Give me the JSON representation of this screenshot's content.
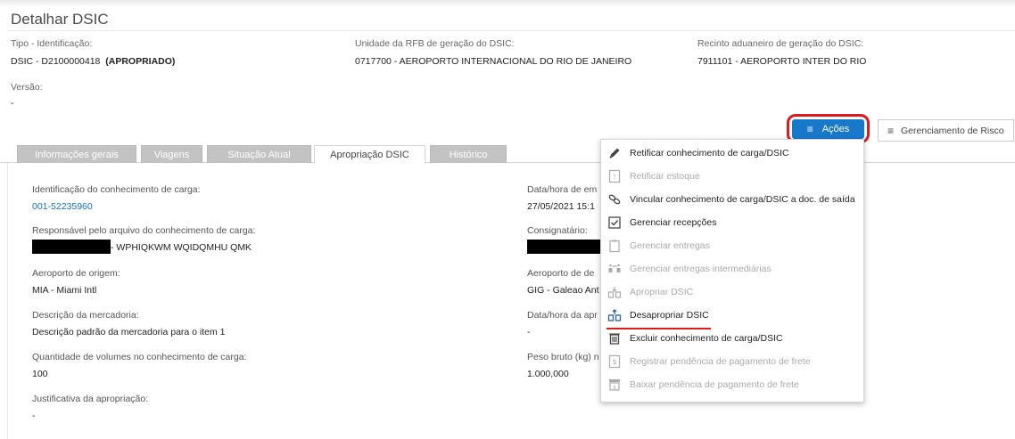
{
  "title": "Detalhar DSIC",
  "header": {
    "tipo_label": "Tipo - Identificação:",
    "tipo_value": "DSIC - D2100000418",
    "tipo_status": "(APROPRIADO)",
    "unidade_label": "Unidade da RFB de geração do DSIC:",
    "unidade_value": "0717700 - AEROPORTO INTERNACIONAL DO RIO DE JANEIRO",
    "recinto_label": "Recinto aduaneiro de geração do DSIC:",
    "recinto_value": "7911101 - AEROPORTO INTER DO RIO",
    "versao_label": "Versão:",
    "versao_value": "-"
  },
  "buttons": {
    "acoes": "Ações",
    "risco": "Gerenciamento de Risco"
  },
  "tabs": [
    {
      "label": "Informações gerais"
    },
    {
      "label": "Viagens"
    },
    {
      "label": "Situação Atual"
    },
    {
      "label": "Apropriação DSIC"
    },
    {
      "label": "Histórico"
    }
  ],
  "fields": {
    "ident_label": "Identificação do conhecimento de carga:",
    "ident_value": "001-52235960",
    "data_label": "Data/hora de em",
    "data_value": "27/05/2021 15:1",
    "resp_label": "Responsável pelo arquivo do conhecimento de carga:",
    "resp_value": "- WPHIQKWM WQIDQMHU QMK",
    "consig_label": "Consignatário:",
    "origem_label": "Aeroporto de origem:",
    "origem_value": "MIA - Miami Intl",
    "destino_label": "Aeroporto de de",
    "destino_value": "GIG - Galeao Ant",
    "desc_label": "Descrição da mercadoria:",
    "desc_value": "Descrição padrão da mercadoria para o item 1",
    "datahora_label": "Data/hora da apr",
    "datahora_value": "-",
    "qtd_label": "Quantidade de volumes no conhecimento de carga:",
    "qtd_value": "100",
    "peso_label": "Peso bruto (kg) n",
    "peso_value": "1.000,000",
    "just_label": "Justificativa da apropriação:",
    "just_value": "-"
  },
  "menu": [
    {
      "label": "Retificar conhecimento de carga/DSIC",
      "icon": "pencil-icon",
      "enabled": true
    },
    {
      "label": "Retificar estoque",
      "icon": "stock-doc-icon",
      "enabled": false
    },
    {
      "label": "Vincular conhecimento de carga/DSIC a doc. de saída",
      "icon": "link-icon",
      "enabled": true
    },
    {
      "label": "Gerenciar recepções",
      "icon": "checkbox-icon",
      "enabled": true
    },
    {
      "label": "Gerenciar entregas",
      "icon": "clipboard-icon",
      "enabled": false
    },
    {
      "label": "Gerenciar entregas intermediárias",
      "icon": "transfer-icon",
      "enabled": false
    },
    {
      "label": "Apropriar DSIC",
      "icon": "appropriate-icon",
      "enabled": false
    },
    {
      "label": "Desapropriar DSIC",
      "icon": "disappropriate-icon",
      "enabled": true
    },
    {
      "label": "Excluir conhecimento de carga/DSIC",
      "icon": "trash-icon",
      "enabled": true
    },
    {
      "label": "Registrar pendência de pagamento de frete",
      "icon": "payment-doc-icon",
      "enabled": false
    },
    {
      "label": "Baixar pendência de pagamento de frete",
      "icon": "payment-lower-icon",
      "enabled": false
    }
  ],
  "colors": {
    "primary": "#1878c9",
    "highlight": "#e0181f",
    "link": "#1a6fc2",
    "tab_inactive": "#c3c3c3"
  }
}
